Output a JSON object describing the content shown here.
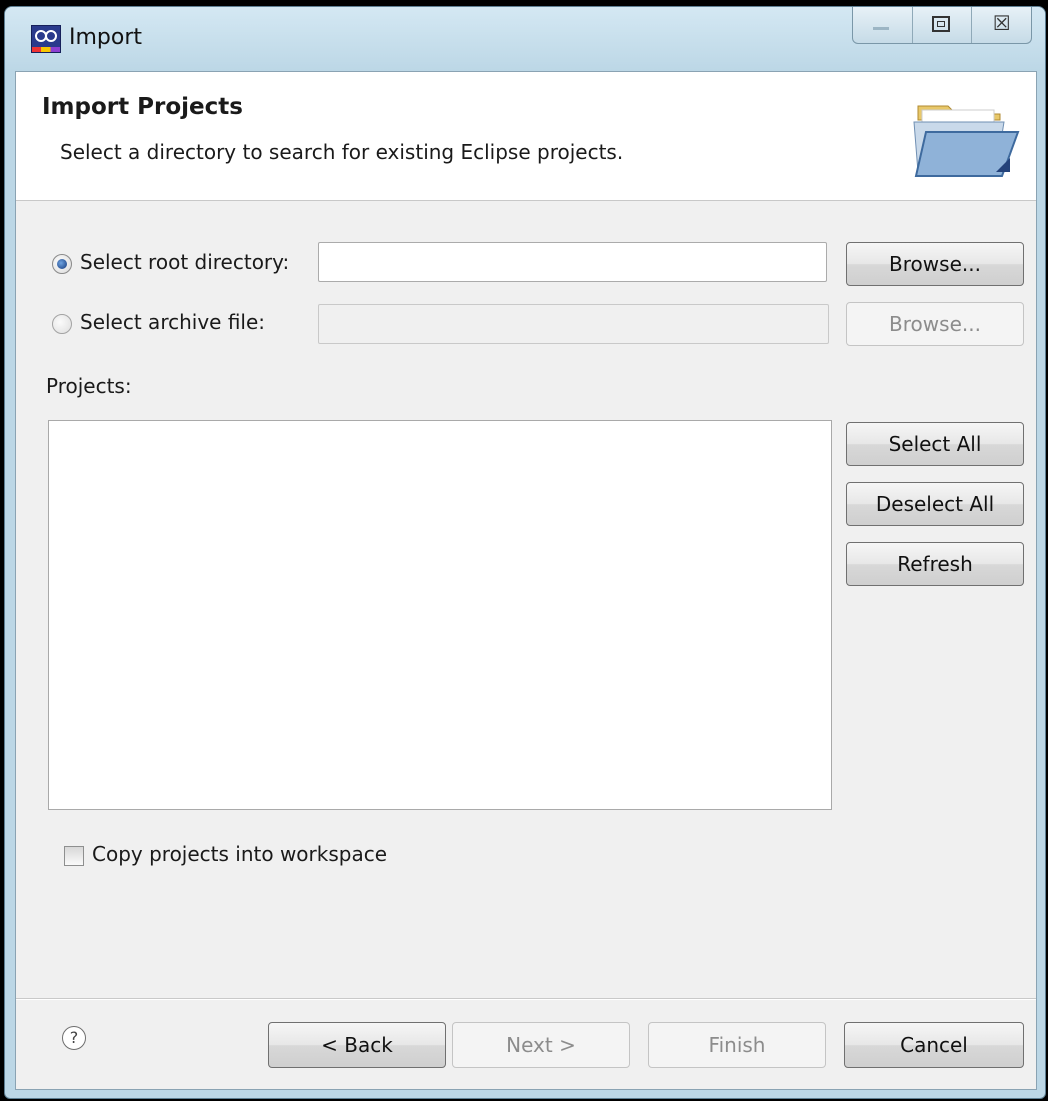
{
  "window": {
    "title": "Import",
    "controls": {
      "minimize": "minimize-icon",
      "maximize": "maximize-icon",
      "close_glyph": "☒"
    }
  },
  "header": {
    "title": "Import Projects",
    "description": "Select a directory to search for existing Eclipse projects."
  },
  "source": {
    "root_directory": {
      "label": "Select root directory:",
      "selected": true,
      "value": "",
      "browse": "Browse..."
    },
    "archive_file": {
      "label": "Select archive file:",
      "selected": false,
      "value": "",
      "browse": "Browse..."
    }
  },
  "projects": {
    "label": "Projects:",
    "items": [],
    "buttons": {
      "select_all": "Select All",
      "deselect_all": "Deselect All",
      "refresh": "Refresh"
    }
  },
  "options": {
    "copy_projects_label": "Copy projects into workspace",
    "copy_projects_checked": false
  },
  "footer": {
    "help": "?",
    "back": "< Back",
    "next": "Next >",
    "finish": "Finish",
    "cancel": "Cancel"
  }
}
